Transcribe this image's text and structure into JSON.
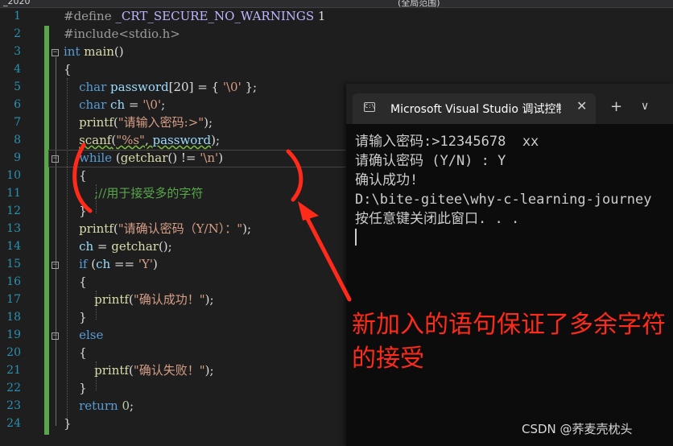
{
  "editor": {
    "top_strip": {
      "left": "_2020",
      "right": "(全局范围)"
    },
    "line_numbers": [
      "1",
      "2",
      "3",
      "4",
      "5",
      "6",
      "7",
      "8",
      "9",
      "10",
      "11",
      "12",
      "13",
      "14",
      "15",
      "16",
      "17",
      "18",
      "19",
      "20",
      "21",
      "22",
      "23",
      "24"
    ],
    "code": {
      "l1_directive": "#define",
      "l1_macro": "_CRT_SECURE_NO_WARNINGS",
      "l1_value": "1",
      "l2_include": "#include<stdio.h>",
      "l3_kw": "int",
      "l3_fn": "main",
      "l3_rest": "()",
      "l4": "{",
      "l5_kw": "char",
      "l5_var": "password",
      "l5_mid": "[20] = { ",
      "l5_str": "'\\0'",
      "l5_end": " };",
      "l6_kw": "char",
      "l6_var": "ch",
      "l6_mid": " = ",
      "l6_str": "'\\0'",
      "l6_end": ";",
      "l7_fn": "printf",
      "l7_open": "(",
      "l7_str": "\"请输入密码:>\"",
      "l7_end": ");",
      "l8_fn": "scanf",
      "l8_open": "(",
      "l8_str": "\"%s\"",
      "l8_comma": ", ",
      "l8_var": "password",
      "l8_end": ");",
      "l9_kw": "while",
      "l9_open": " (",
      "l9_fn": "getchar",
      "l9_mid": "() != ",
      "l9_str": "'\\n'",
      "l9_end": ")",
      "l10": "{",
      "l11_comment": ";//用于接受多的字符",
      "l12": "}",
      "l13_fn": "printf",
      "l13_open": "(",
      "l13_str": "\"请确认密码（Y/N）：\"",
      "l13_end": ");",
      "l14_var": "ch",
      "l14_mid": " = ",
      "l14_fn": "getchar",
      "l14_end": "();",
      "l15_kw": "if",
      "l15_open": " (",
      "l15_var": "ch",
      "l15_mid": " == ",
      "l15_str": "'Y'",
      "l15_end": ")",
      "l16": "{",
      "l17_fn": "printf",
      "l17_open": "(",
      "l17_str": "\"确认成功！\"",
      "l17_end": ");",
      "l18": "}",
      "l19_kw": "else",
      "l20": "{",
      "l21_fn": "printf",
      "l21_open": "(",
      "l21_str": "\"确认失败！\"",
      "l21_end": ");",
      "l22": "}",
      "l23_kw": "return",
      "l23_num": "0",
      "l23_end": ";",
      "l24": "}"
    }
  },
  "terminal": {
    "tab_title": "Microsoft Visual Studio 调试控制台",
    "close_glyph": "✕",
    "new_tab_glyph": "+",
    "dropdown_glyph": "∨",
    "lines": [
      "请输入密码:>12345678  xx",
      "请确认密码 (Y/N) : Y",
      "确认成功!",
      "D:\\bite-gitee\\why-c-learning-journey",
      "按任意键关闭此窗口. . ."
    ]
  },
  "annotation": {
    "text": "新加入的语句保证了多余字符的接受",
    "color": "#ff2a1a"
  },
  "watermark": "CSDN @荞麦壳枕头",
  "colors": {
    "editor_bg": "#1e1e1e",
    "keyword": "#569cd6",
    "string": "#d69d85",
    "comment": "#57a64a",
    "line_number": "#2b91af",
    "terminal_bg": "#0c0c0c"
  }
}
